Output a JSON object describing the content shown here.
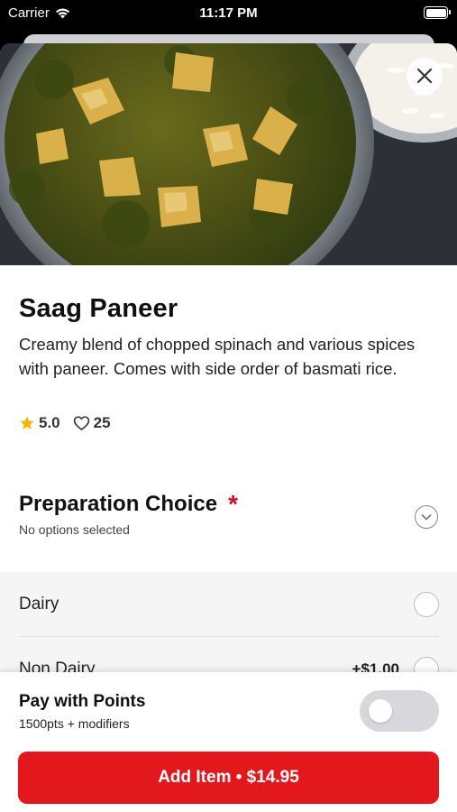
{
  "status_bar": {
    "carrier": "Carrier",
    "time": "11:17 PM"
  },
  "item": {
    "title": "Saag Paneer",
    "description": "Creamy blend of chopped spinach and various spices with paneer. Comes with side order of basmati rice.",
    "rating": "5.0",
    "likes": "25",
    "image_icon": "food-photo"
  },
  "preparation": {
    "title": "Preparation Choice",
    "required_marker": "*",
    "subtitle": "No options selected",
    "options": [
      {
        "label": "Dairy",
        "price": ""
      },
      {
        "label": "Non Dairy",
        "price": "+$1.00"
      }
    ]
  },
  "points": {
    "title": "Pay with Points",
    "subtitle": "1500pts + modifiers",
    "enabled": false
  },
  "add_button": {
    "label": "Add Item • $14.95"
  },
  "colors": {
    "accent": "#e3181d",
    "required": "#c8102e",
    "star": "#f5b400"
  }
}
